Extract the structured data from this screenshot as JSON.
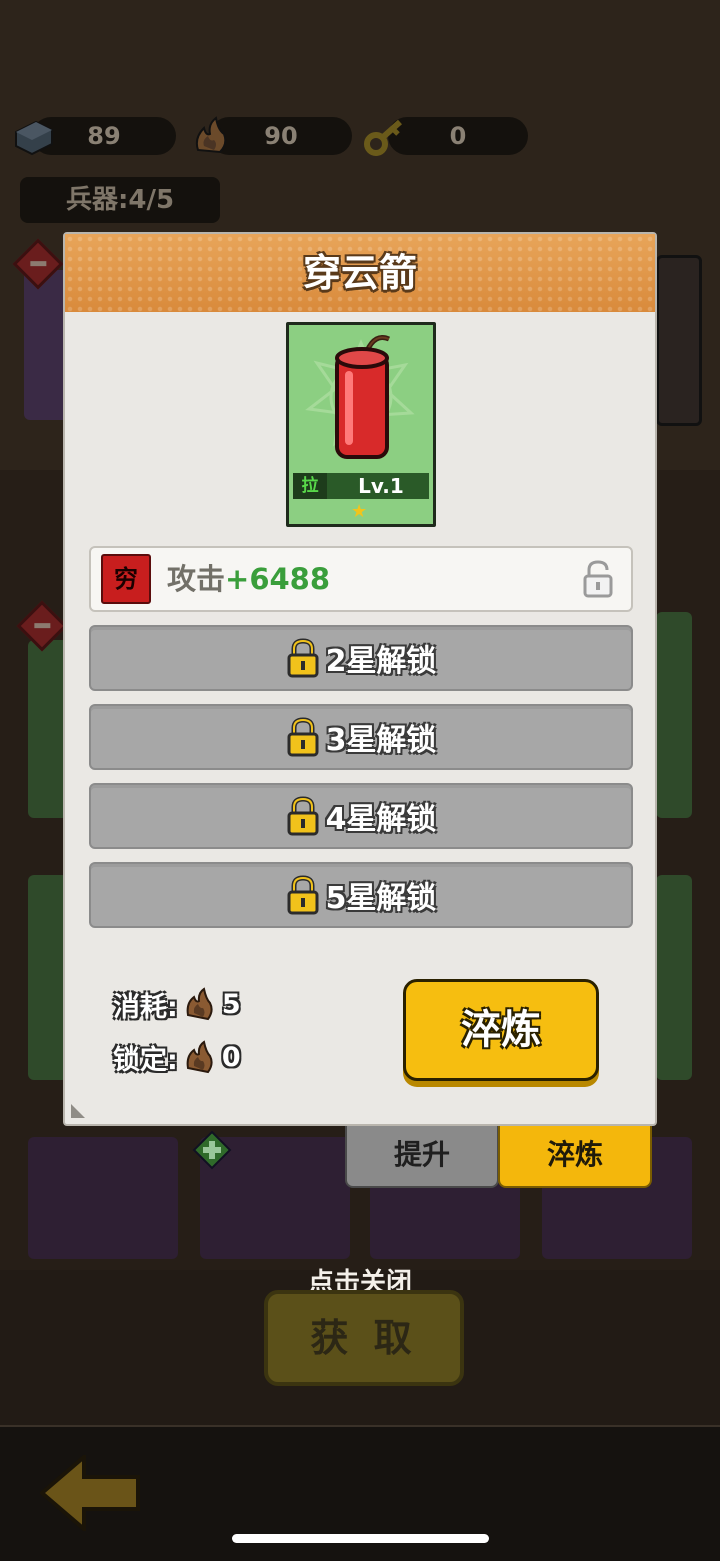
{
  "resources": [
    {
      "icon": "ore-block-icon",
      "value": "89"
    },
    {
      "icon": "flame-stone-icon",
      "value": "90"
    },
    {
      "icon": "key-icon",
      "value": "0"
    }
  ],
  "weapons_count": "兵器:4/5",
  "modal": {
    "title": "穿云箭",
    "weapon": {
      "icon": "firecracker-icon",
      "tag": "拉",
      "level": "Lv.1",
      "stars": "★"
    },
    "attribute": {
      "badge": "穷",
      "label": "攻击",
      "value": "+6488"
    },
    "locked_slots": [
      {
        "label": "2星解锁"
      },
      {
        "label": "3星解锁"
      },
      {
        "label": "4星解锁"
      },
      {
        "label": "5星解锁"
      }
    ],
    "cost": {
      "consume_label": "消耗:",
      "consume_value": "5",
      "lock_label": "锁定:",
      "lock_value": "0"
    },
    "refine_button": "淬炼"
  },
  "tabs": {
    "upgrade": "提升",
    "refine": "淬炼"
  },
  "close_hint": "点击关闭",
  "get_button": "获 取",
  "colors": {
    "accent": "#f6be10",
    "header": "#e09848",
    "attr_green": "#3a9e3b",
    "card_green": "#8ccf82"
  }
}
